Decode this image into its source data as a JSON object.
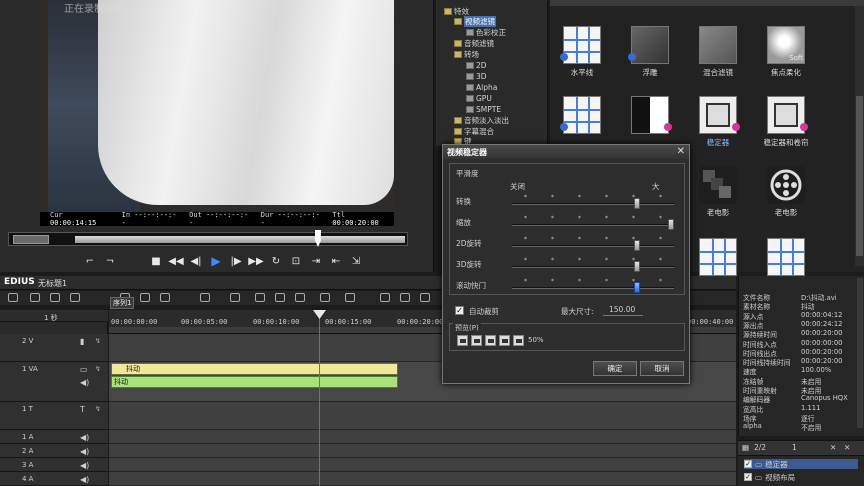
{
  "preview": {
    "overlay_text": "正在录制信息...",
    "timecodes": [
      {
        "label": "Cur",
        "value": "00:00:14:15"
      },
      {
        "label": "In",
        "value": "--:--:--:--"
      },
      {
        "label": "Out",
        "value": "--:--:--:--"
      },
      {
        "label": "Dur",
        "value": "--:--:--:--"
      },
      {
        "label": "Ttl",
        "value": "00:00:20:00"
      }
    ]
  },
  "tree": {
    "items": [
      {
        "label": "特效"
      },
      {
        "label": "视频滤镜"
      },
      {
        "label": "色彩校正"
      },
      {
        "label": "音频滤镜"
      },
      {
        "label": "转场"
      },
      {
        "label": "2D"
      },
      {
        "label": "3D"
      },
      {
        "label": "Alpha"
      },
      {
        "label": "GPU"
      },
      {
        "label": "SMPTE"
      },
      {
        "label": "音频淡入淡出"
      },
      {
        "label": "字幕混合"
      },
      {
        "label": "键"
      }
    ]
  },
  "palette": {
    "effects": [
      {
        "label": "水平线",
        "icon": "grid-lines-icon"
      },
      {
        "label": "浮雕",
        "icon": "emboss-icon"
      },
      {
        "label": "混合滤镜",
        "icon": "blend-filter-icon"
      },
      {
        "label": "焦点柔化",
        "icon": "soft-focus-icon",
        "thumb_text": "Soft"
      },
      {
        "label": "",
        "icon": "grid-lines-icon"
      },
      {
        "label": "",
        "icon": "half-contrast-icon"
      },
      {
        "label": "稳定器",
        "icon": "stabilizer-icon"
      },
      {
        "label": "稳定器和卷帘",
        "icon": "stabilizer-rolling-icon"
      },
      {
        "label": "老电影",
        "icon": "old-film-stack-icon"
      },
      {
        "label": "老电影",
        "icon": "old-film-reel-icon"
      }
    ]
  },
  "timeline": {
    "app_name": "EDIUS",
    "project_name": "无标题1",
    "sequence_tab": "序列1",
    "zoom_label": "1 秒",
    "ruler_ticks": [
      "00:00:00:00",
      "00:00:05:00",
      "00:00:10:00",
      "00:00:15:00",
      "00:00:20:00",
      "00:00:40:00"
    ],
    "tracks": [
      {
        "name": "2 V"
      },
      {
        "name": "1 VA"
      },
      {
        "name": "1 T"
      },
      {
        "name": "1 A"
      },
      {
        "name": "2 A"
      },
      {
        "name": "3 A"
      },
      {
        "name": "4 A"
      }
    ],
    "video_clip_label": "抖动",
    "audio_clip_label": "抖动"
  },
  "dialog": {
    "title": "视频稳定器",
    "group_title": "平滑度",
    "col_off": "关闭",
    "col_max": "大",
    "sliders": [
      {
        "label": "转换",
        "value": 0.78
      },
      {
        "label": "缩放",
        "value": 1.0
      },
      {
        "label": "2D旋转",
        "value": 0.78
      },
      {
        "label": "3D旋转",
        "value": 0.78
      },
      {
        "label": "滚动快门",
        "value": 0.78
      }
    ],
    "auto_crop_label": "自动裁剪",
    "max_size_label": "最大尺寸:",
    "max_size_value": "150.00",
    "preview_group": "预览(P)",
    "preview_pct": "50%",
    "ok_label": "确定",
    "cancel_label": "取消"
  },
  "info": {
    "rows": [
      {
        "k": "文件名称",
        "v": "D:\\抖动.avi"
      },
      {
        "k": "素材名称",
        "v": "抖动"
      },
      {
        "k": "源入点",
        "v": "00:00:04:12"
      },
      {
        "k": "源出点",
        "v": "00:00:24:12"
      },
      {
        "k": "源持续时间",
        "v": "00:00:20:00"
      },
      {
        "k": "时间线入点",
        "v": "00:00:00:00"
      },
      {
        "k": "时间线出点",
        "v": "00:00:20:00"
      },
      {
        "k": "时间线持续时间",
        "v": "00:00:20:00"
      },
      {
        "k": "速度",
        "v": "100.00%"
      },
      {
        "k": "冻结帧",
        "v": "未启用"
      },
      {
        "k": "时间重映射",
        "v": "未启用"
      },
      {
        "k": "编解码器",
        "v": "Canopus HQX"
      },
      {
        "k": "宽高比",
        "v": "1.111"
      },
      {
        "k": "场序",
        "v": "逐行"
      },
      {
        "k": "alpha",
        "v": "不启用"
      }
    ]
  },
  "fxlist": {
    "page": "2/2",
    "count": "1",
    "items": [
      {
        "label": "稳定器",
        "checked": true
      },
      {
        "label": "视频布局",
        "checked": true
      }
    ]
  }
}
